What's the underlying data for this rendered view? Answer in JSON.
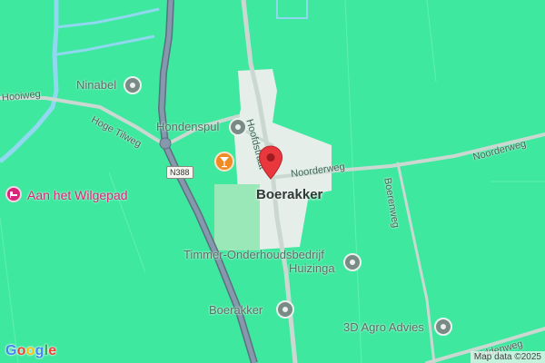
{
  "map": {
    "place_name": "Boerakker",
    "attribution": "Map data ©2025",
    "logo": {
      "letters": [
        "G",
        "o",
        "o",
        "g",
        "l",
        "e"
      ],
      "colors": [
        "#4285F4",
        "#EA4335",
        "#FBBC05",
        "#4285F4",
        "#34A853",
        "#EA4335"
      ]
    },
    "colors": {
      "land": "#3ee89f",
      "road": "#cbd8d2",
      "highway": "#7d91a6",
      "water": "#8fd8ef",
      "built_area": "#e6eeea",
      "park": "#9ae8b7",
      "marker": "#e8383d",
      "poi_pink": "#d9267a",
      "poi_orange": "#f08a24"
    },
    "roads": [
      "Hooiweg",
      "Hoge Tilweg",
      "Hoofdstraat",
      "Noorderweg",
      "Noorderweg",
      "Boerenweg",
      "Middenweg"
    ],
    "route_shield": "N388",
    "pois": [
      {
        "name": "Ninabel",
        "icon": "pin-icon"
      },
      {
        "name": "Hondenspul",
        "icon": "pin-icon"
      },
      {
        "name": "Aan het Wilgepad",
        "icon": "bed-icon"
      },
      {
        "name": "Timmer-Onderhoudsbedrijf",
        "name_line2": "Huizinga",
        "icon": "pin-icon"
      },
      {
        "name": "Boerakker",
        "icon": "pin-icon"
      },
      {
        "name": "3D Agro Advies",
        "icon": "pin-icon"
      }
    ],
    "bar_icon": "cocktail-icon",
    "marker_icon": "map-marker-icon"
  }
}
